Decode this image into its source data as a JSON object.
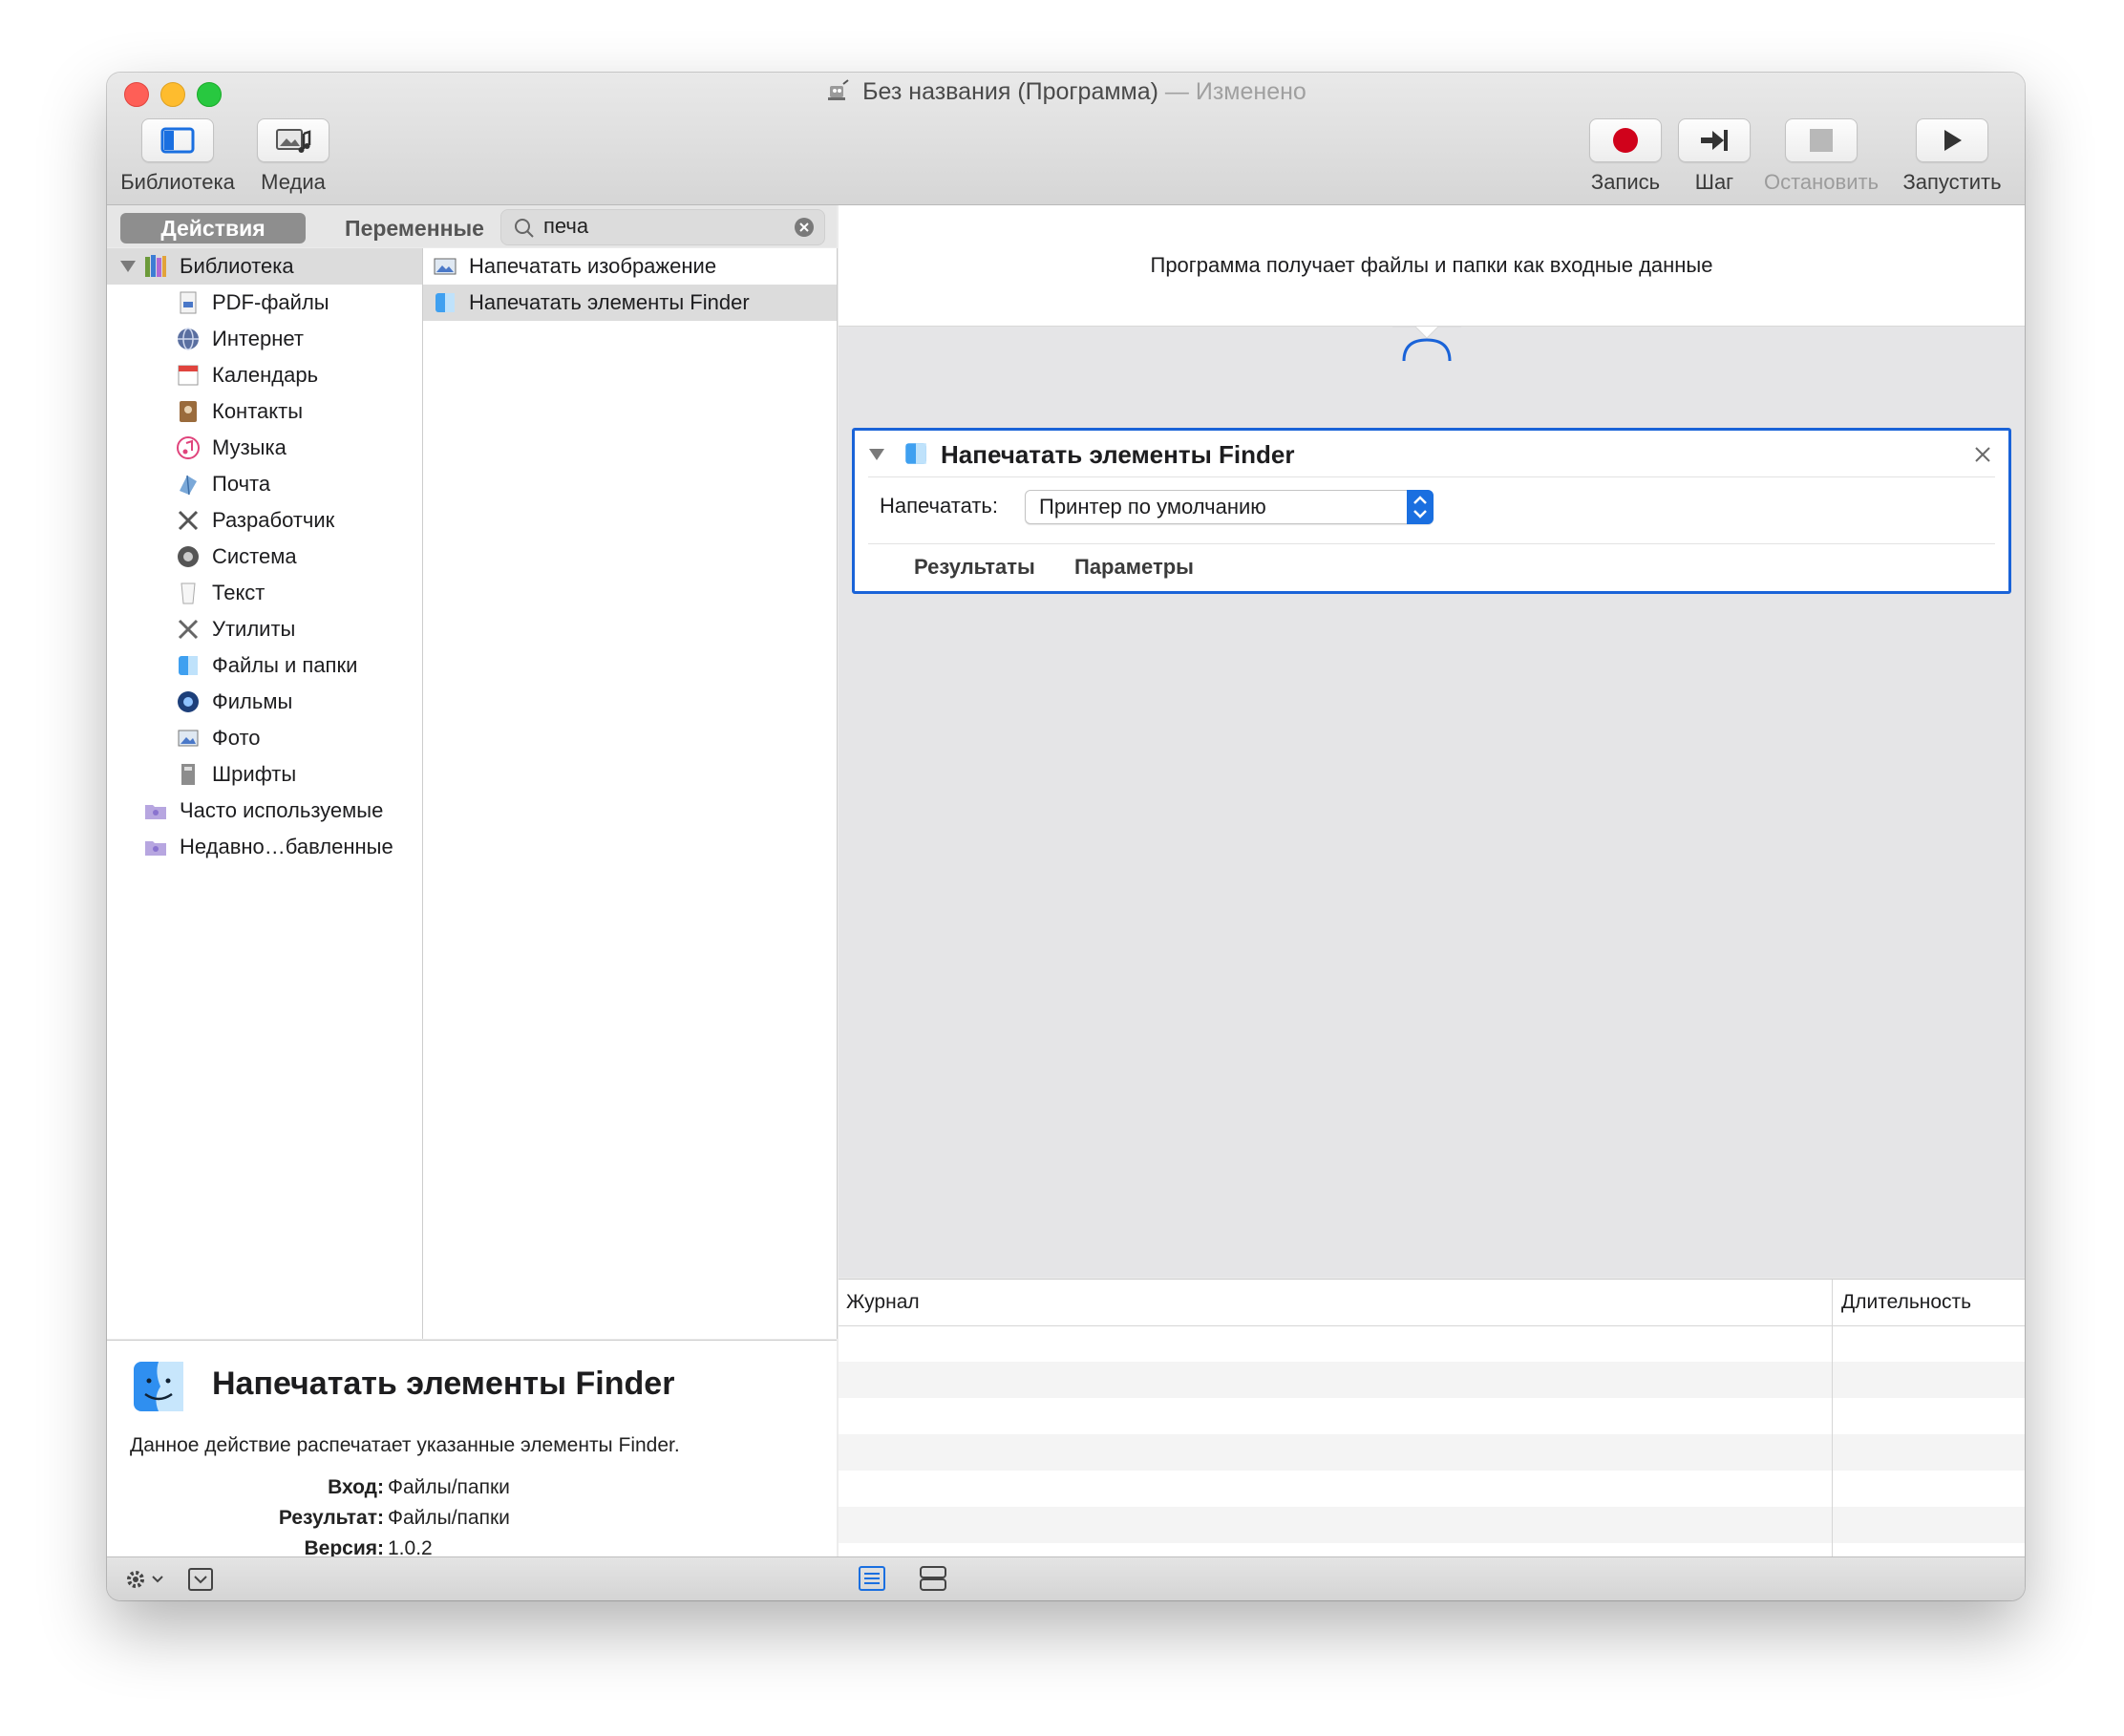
{
  "window": {
    "title": "Без названия (Программа)",
    "title_sep": " — ",
    "title_status": "Изменено"
  },
  "toolbar": {
    "library_label": "Библиотека",
    "media_label": "Медиа",
    "record_label": "Запись",
    "step_label": "Шаг",
    "stop_label": "Остановить",
    "run_label": "Запустить"
  },
  "tabs": {
    "actions_label": "Действия",
    "variables_label": "Переменные"
  },
  "search": {
    "value": "печа",
    "placeholder": ""
  },
  "library": {
    "root_label": "Библиотека",
    "items": [
      {
        "label": "PDF-файлы",
        "icon": "pdf-icon"
      },
      {
        "label": "Интернет",
        "icon": "globe-icon"
      },
      {
        "label": "Календарь",
        "icon": "calendar-icon"
      },
      {
        "label": "Контакты",
        "icon": "contacts-icon"
      },
      {
        "label": "Музыка",
        "icon": "music-icon"
      },
      {
        "label": "Почта",
        "icon": "mail-icon"
      },
      {
        "label": "Разработчик",
        "icon": "tools-icon"
      },
      {
        "label": "Система",
        "icon": "system-icon"
      },
      {
        "label": "Текст",
        "icon": "text-icon"
      },
      {
        "label": "Утилиты",
        "icon": "utilities-icon"
      },
      {
        "label": "Файлы и папки",
        "icon": "finder-icon"
      },
      {
        "label": "Фильмы",
        "icon": "quicktime-icon"
      },
      {
        "label": "Фото",
        "icon": "photo-icon"
      },
      {
        "label": "Шрифты",
        "icon": "fonts-icon"
      }
    ],
    "smart_groups": [
      {
        "label": "Часто используемые",
        "icon": "smart-folder-icon"
      },
      {
        "label": "Недавно…бавленные",
        "icon": "smart-folder-icon"
      }
    ]
  },
  "actions": {
    "items": [
      {
        "label": "Напечатать изображение",
        "icon": "print-image-icon"
      },
      {
        "label": "Напечатать элементы Finder",
        "icon": "finder-icon"
      }
    ],
    "selected_index": 1
  },
  "description": {
    "title": "Напечатать элементы Finder",
    "text": "Данное действие распечатает указанные элементы Finder.",
    "input_label": "Вход:",
    "input_value": "Файлы/папки",
    "result_label": "Результат:",
    "result_value": "Файлы/папки",
    "version_label": "Версия:",
    "version_value": "1.0.2"
  },
  "workflow": {
    "header_text": "Программа получает файлы и папки как входные данные",
    "card": {
      "title": "Напечатать элементы Finder",
      "print_label": "Напечатать:",
      "printer_value": "Принтер по умолчанию",
      "results_tab": "Результаты",
      "params_tab": "Параметры"
    }
  },
  "log": {
    "col_log": "Журнал",
    "col_duration": "Длительность"
  },
  "colors": {
    "accent": "#1a63d8",
    "record_red": "#d0021b",
    "close_red": "#fe5f57",
    "minimize_yellow": "#febc2e",
    "zoom_green": "#28c840"
  }
}
